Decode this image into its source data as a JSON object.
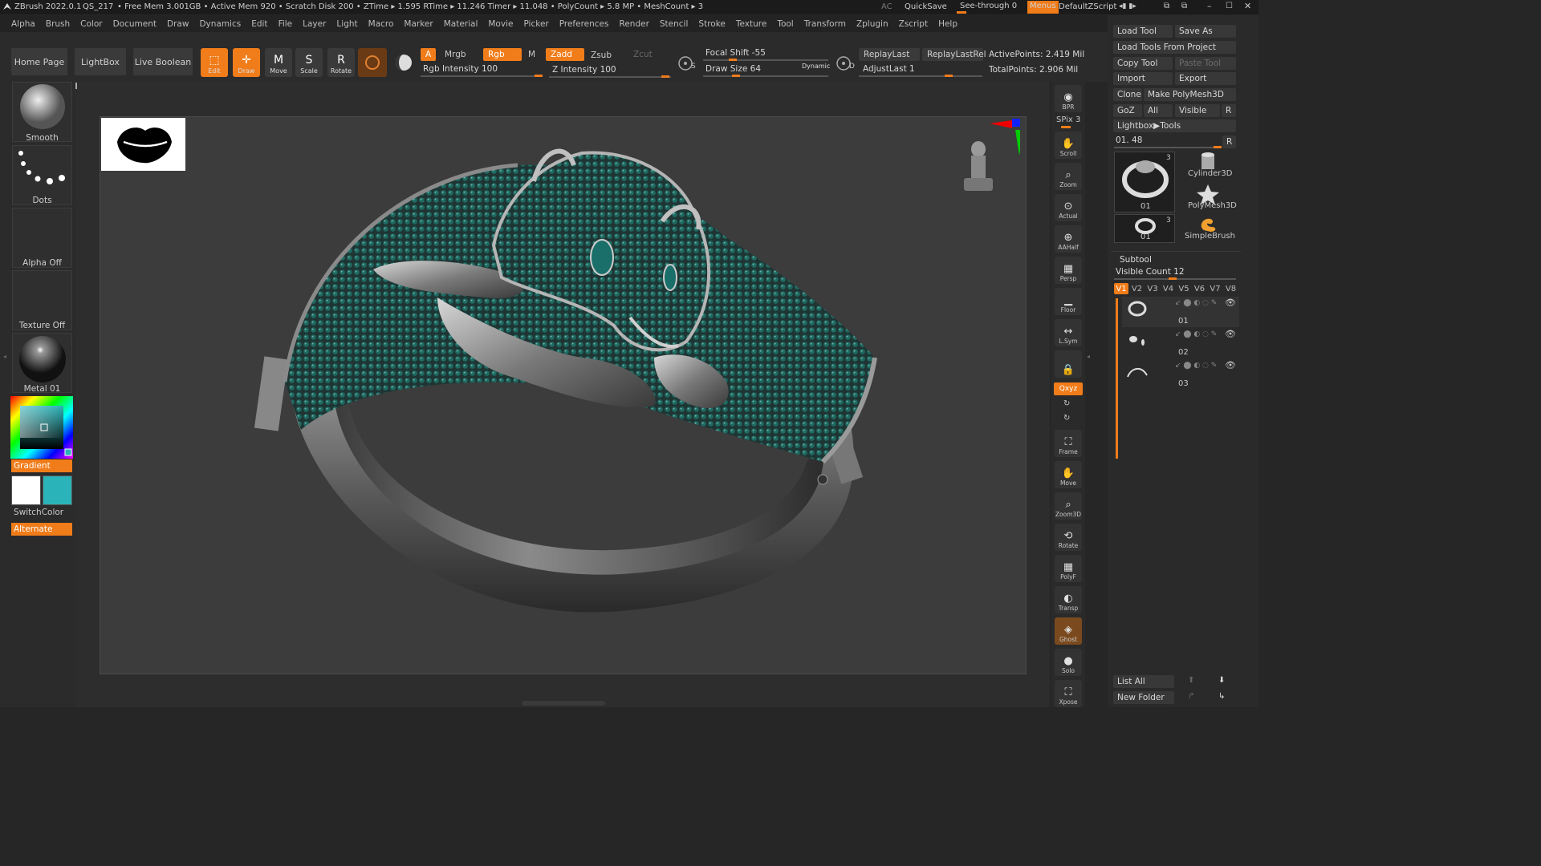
{
  "titlebar": {
    "app": "ZBrush 2022.0.1",
    "file": "QS_217",
    "stats": "• Free Mem 3.001GB • Active Mem 920 • Scratch Disk 200 • ZTime ▸ 1.595 RTime ▸ 11.246 Timer ▸ 11.048 • PolyCount ▸ 5.8 MP • MeshCount ▸ 3",
    "ac": "AC",
    "quicksave": "QuickSave",
    "seethrough": "See-through  0",
    "menus": "Menus",
    "script": "DefaultZScript"
  },
  "menubar": [
    "Alpha",
    "Brush",
    "Color",
    "Document",
    "Draw",
    "Dynamics",
    "Edit",
    "File",
    "Layer",
    "Light",
    "Macro",
    "Marker",
    "Material",
    "Movie",
    "Picker",
    "Preferences",
    "Render",
    "Stencil",
    "Stroke",
    "Texture",
    "Tool",
    "Transform",
    "Zplugin",
    "Zscript",
    "Help"
  ],
  "shelf": {
    "home": "Home Page",
    "lightbox": "LightBox",
    "liveboolean": "Live Boolean",
    "tools": [
      {
        "label": "Edit",
        "icon": "edit-icon",
        "glyph": "⬚",
        "selected": true
      },
      {
        "label": "Draw",
        "icon": "draw-icon",
        "glyph": "✛",
        "selected": true
      },
      {
        "label": "Move",
        "icon": "move-icon",
        "glyph": "M",
        "selected": false
      },
      {
        "label": "Scale",
        "icon": "scale-icon",
        "glyph": "S",
        "selected": false
      },
      {
        "label": "Rotate",
        "icon": "rotate-icon",
        "glyph": "R",
        "selected": false
      }
    ],
    "a": "A",
    "mrgb": "Mrgb",
    "rgb": "Rgb",
    "m": "M",
    "zadd": "Zadd",
    "zsub": "Zsub",
    "zcut": "Zcut",
    "rgb_intensity": "Rgb Intensity 100",
    "z_intensity": "Z Intensity 100",
    "focal_shift": "Focal Shift -55",
    "draw_size": "Draw Size 64",
    "dynamic": "Dynamic",
    "replaylast": "ReplayLast",
    "replaylastrel": "ReplayLastRel",
    "adjustlast": "AdjustLast 1",
    "activepoints": "ActivePoints: 2.419 Mil",
    "totalpoints": "TotalPoints: 2.906 Mil",
    "s": "S",
    "d": "D"
  },
  "leftpanel": {
    "brush": "Smooth",
    "stroke": "Dots",
    "alpha": "Alpha Off",
    "texture": "Texture Off",
    "material": "Metal 01",
    "gradient": "Gradient",
    "switchcolor": "SwitchColor",
    "alternate": "Alternate",
    "colors": {
      "main": "#ffffff",
      "secondary": "#2ab3b8"
    }
  },
  "righttoolbar": [
    {
      "label": "BPR",
      "icon": "bpr-icon",
      "glyph": "◉"
    },
    {
      "label": "SPix 3",
      "icon": "spix-icon",
      "glyph": ""
    },
    {
      "label": "Scroll",
      "icon": "scroll-icon",
      "glyph": "✋"
    },
    {
      "label": "Zoom",
      "icon": "zoom-icon",
      "glyph": "🔍"
    },
    {
      "label": "Actual",
      "icon": "actual-icon",
      "glyph": "⊙"
    },
    {
      "label": "AAHalf",
      "icon": "aahalf-icon",
      "glyph": "⊕"
    },
    {
      "label": "Persp",
      "icon": "persp-icon",
      "glyph": "▦"
    },
    {
      "label": "Floor",
      "icon": "floor-icon",
      "glyph": "▁"
    },
    {
      "label": "L.Sym",
      "icon": "lsym-icon",
      "glyph": "↔"
    },
    {
      "label": "",
      "icon": "lock-icon",
      "glyph": "🔒"
    },
    {
      "label": "Qxyz",
      "icon": "xyz-icon",
      "glyph": ""
    },
    {
      "label": "Frame",
      "icon": "frame-icon",
      "glyph": "⛶"
    },
    {
      "label": "Move",
      "icon": "move-view-icon",
      "glyph": "✋"
    },
    {
      "label": "Zoom3D",
      "icon": "zoom3d-icon",
      "glyph": "🔍"
    },
    {
      "label": "Rotate",
      "icon": "rotate-view-icon",
      "glyph": "⟲"
    },
    {
      "label": "PolyF",
      "icon": "polyf-icon",
      "glyph": "▦"
    },
    {
      "label": "Transp",
      "icon": "transp-icon",
      "glyph": "◐"
    },
    {
      "label": "Ghost",
      "icon": "ghost-icon",
      "glyph": "◈"
    },
    {
      "label": "Solo",
      "icon": "solo-icon",
      "glyph": "●"
    },
    {
      "label": "Xpose",
      "icon": "xpose-icon",
      "glyph": "⛶"
    }
  ],
  "toolpanel": {
    "load": "Load Tool",
    "saveas": "Save As",
    "loadfromproject": "Load Tools From Project",
    "copy": "Copy Tool",
    "paste": "Paste Tool",
    "import": "Import",
    "export": "Export",
    "clone": "Clone",
    "makepoly": "Make PolyMesh3D",
    "goz": "GoZ",
    "all": "All",
    "visible": "Visible",
    "r": "R",
    "lightboxtools": "Lightbox▶Tools",
    "slider": "01. 48",
    "thumbs": [
      {
        "label": "01",
        "count": "3"
      },
      {
        "label": "Cylinder3D",
        "count": ""
      },
      {
        "label": "PolyMesh3D",
        "count": ""
      },
      {
        "label": "01",
        "count": "3"
      },
      {
        "label": "SimpleBrush",
        "count": ""
      }
    ],
    "subtool_title": "Subtool",
    "visible_count": "Visible Count 12",
    "vtabs": [
      "V1",
      "V2",
      "V3",
      "V4",
      "V5",
      "V6",
      "V7",
      "V8"
    ],
    "subtools": [
      "01",
      "02",
      "03"
    ],
    "listall": "List All",
    "newfolder": "New Folder"
  }
}
